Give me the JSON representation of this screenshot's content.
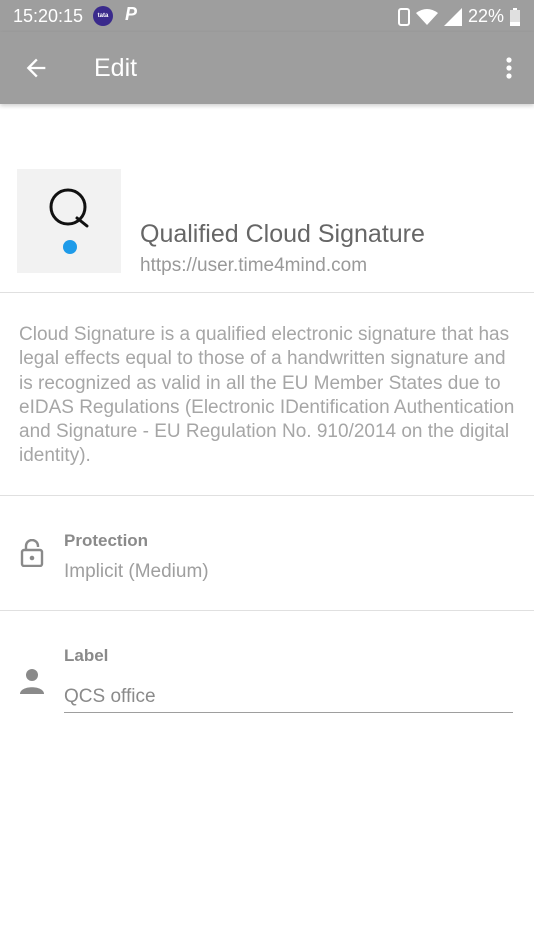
{
  "status_bar": {
    "time": "15:20:15",
    "app_badge": "tata",
    "app_letter": "P",
    "battery": "22%"
  },
  "app_bar": {
    "title": "Edit",
    "back_icon": "arrow-left-icon",
    "menu_icon": "more-vert-icon"
  },
  "service": {
    "logo_letter": "Q",
    "name": "Qualified Cloud Signature",
    "url": "https://user.time4mind.com",
    "accent_color": "#1e9be9"
  },
  "description": "Cloud Signature is a qualified electronic signature that has legal effects equal to those of a handwritten signature and is recognized as valid in all the EU Member States due to eIDAS Regulations (Electronic IDentification Authentication and Signature - EU Regulation No. 910/2014 on the digital identity).",
  "protection": {
    "label": "Protection",
    "value": "Implicit (Medium)",
    "icon": "lock-icon"
  },
  "label_field": {
    "label": "Label",
    "value": "QCS office",
    "icon": "person-icon"
  }
}
